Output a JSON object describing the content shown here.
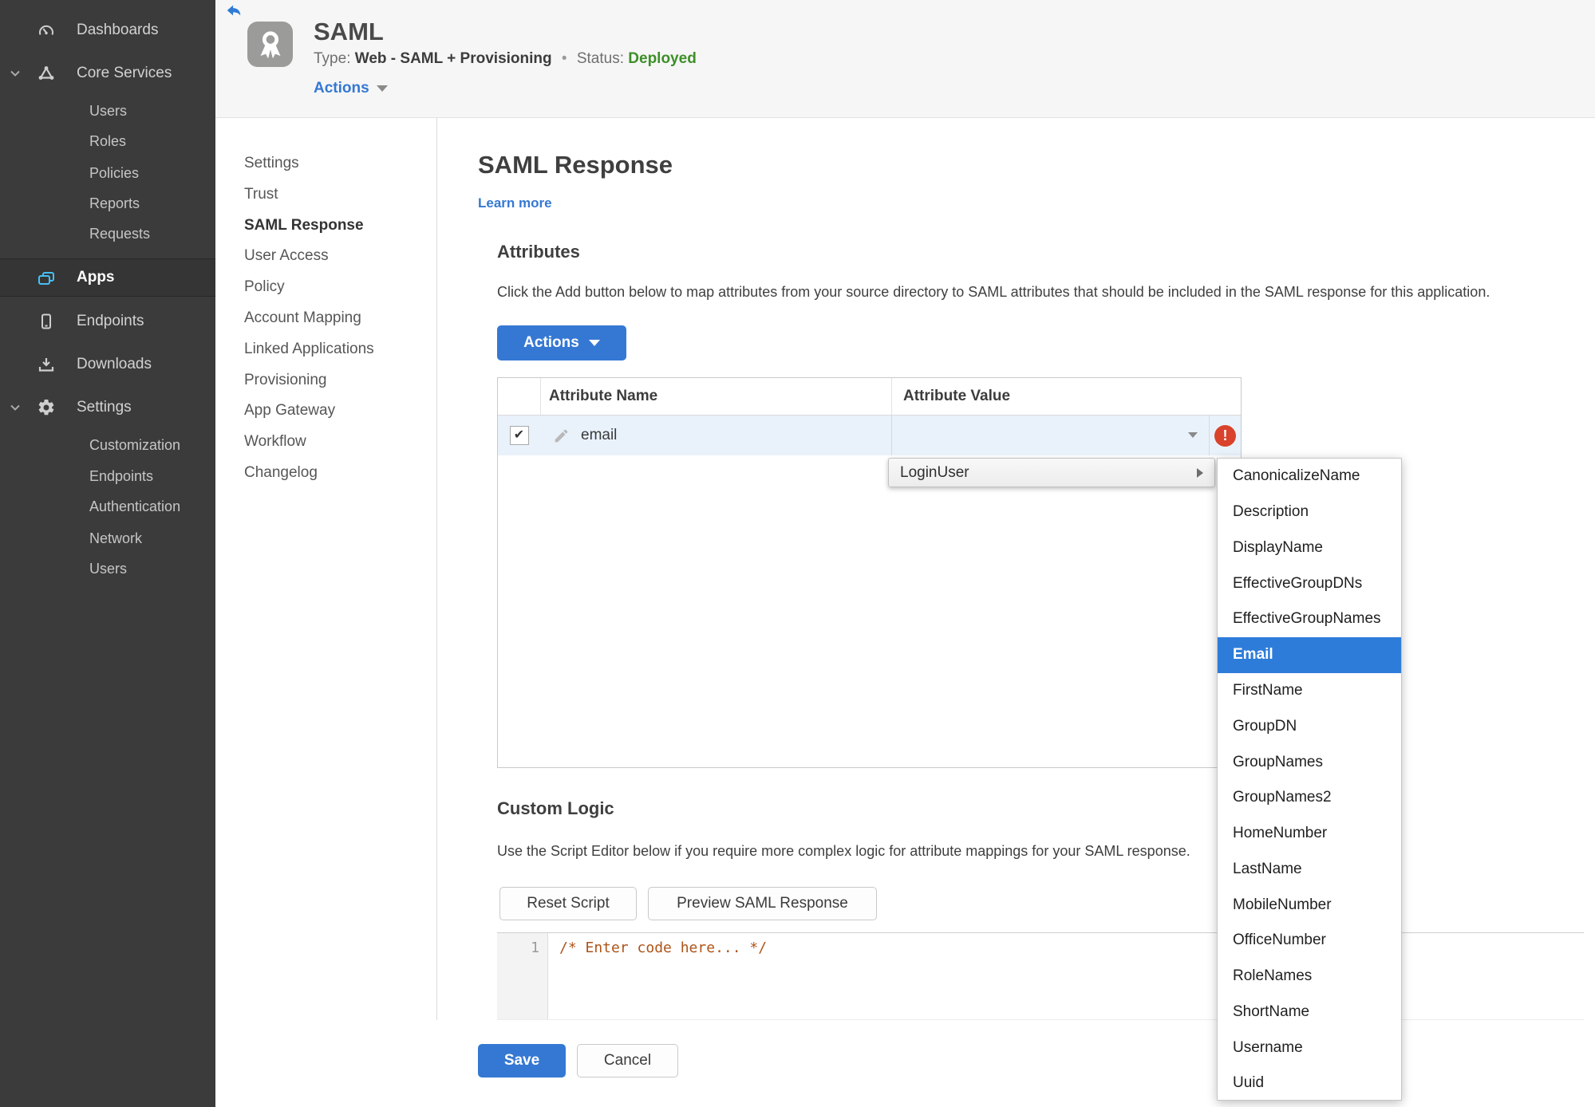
{
  "colors": {
    "accent_blue": "#3578d3",
    "selection_blue": "#2e7cd9",
    "status_green": "#3d8f27",
    "error_red": "#d9422b",
    "row_highlight_blue": "#e9f2fb",
    "sidebar_bg": "#3b3b3b",
    "editor_comment": "#ad5418"
  },
  "sidebar": {
    "items": [
      {
        "label": "Dashboards",
        "icon": "gauge",
        "expanded": false,
        "active": false,
        "children": []
      },
      {
        "label": "Core Services",
        "icon": "core-services",
        "expanded": true,
        "active": false,
        "children": [
          "Users",
          "Roles",
          "Policies",
          "Reports",
          "Requests"
        ]
      },
      {
        "label": "Apps",
        "icon": "apps",
        "expanded": false,
        "active": true,
        "children": []
      },
      {
        "label": "Endpoints",
        "icon": "device",
        "expanded": false,
        "active": false,
        "children": []
      },
      {
        "label": "Downloads",
        "icon": "download",
        "expanded": false,
        "active": false,
        "children": []
      },
      {
        "label": "Settings",
        "icon": "gear",
        "expanded": true,
        "active": false,
        "children": [
          "Customization",
          "Endpoints",
          "Authentication",
          "Network",
          "Users"
        ]
      }
    ]
  },
  "header": {
    "app_title": "SAML",
    "type_label": "Type:",
    "type_value": "Web - SAML + Provisioning",
    "separator": "•",
    "status_label": "Status:",
    "status_value": "Deployed",
    "actions_label": "Actions"
  },
  "subnav": {
    "active": "SAML Response",
    "items": [
      "Settings",
      "Trust",
      "SAML Response",
      "User Access",
      "Policy",
      "Account Mapping",
      "Linked Applications",
      "Provisioning",
      "App Gateway",
      "Workflow",
      "Changelog"
    ]
  },
  "main": {
    "title": "SAML Response",
    "learn_more": "Learn more",
    "attributes": {
      "heading": "Attributes",
      "description": "Click the Add button below to map attributes from your source directory to SAML attributes that should be included in the SAML response for this application.",
      "actions_button": "Actions",
      "table": {
        "columns": [
          "Attribute Name",
          "Attribute Value"
        ],
        "rows": [
          {
            "name": "email",
            "value": "",
            "checked": true,
            "error": true
          }
        ]
      }
    },
    "menu": {
      "label": "LoginUser",
      "selected": "Email",
      "submenu": [
        "CanonicalizeName",
        "Description",
        "DisplayName",
        "EffectiveGroupDNs",
        "EffectiveGroupNames",
        "Email",
        "FirstName",
        "GroupDN",
        "GroupNames",
        "GroupNames2",
        "HomeNumber",
        "LastName",
        "MobileNumber",
        "OfficeNumber",
        "RoleNames",
        "ShortName",
        "Username",
        "Uuid"
      ]
    },
    "custom_logic": {
      "heading": "Custom Logic",
      "description": "Use the Script Editor below if you require more complex logic for attribute mappings for your SAML response.",
      "reset_button": "Reset Script",
      "preview_button": "Preview SAML Response",
      "editor": {
        "line_number": "1",
        "code": "/* Enter code here... */"
      }
    },
    "save_button": "Save",
    "cancel_button": "Cancel"
  }
}
